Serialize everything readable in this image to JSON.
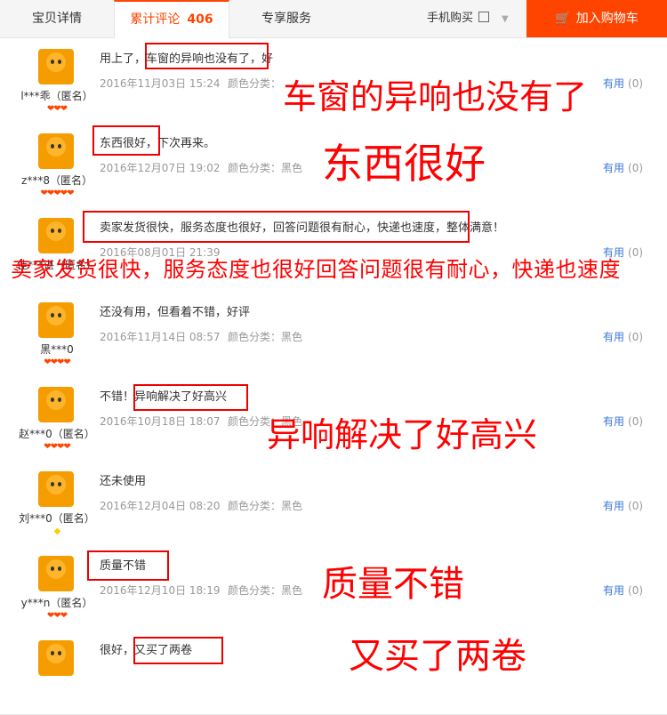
{
  "tabs": {
    "details": "宝贝详情",
    "reviews": "累计评论",
    "reviews_count": "406",
    "services": "专享服务",
    "mobile": "手机购买",
    "cart": "加入购物车"
  },
  "colors": {
    "accent": "#ff4400",
    "link": "#3c78d8",
    "annotation": "#ff0000"
  },
  "useful_label": "有用",
  "reviews": [
    {
      "user": "l***乖（匿名）",
      "content": "用上了，车窗的异响也没有了，好",
      "date": "2016年11月03日 15:24",
      "color": "颜色分类：",
      "useful": "(0)",
      "annotation": "车窗的异响也没有了",
      "hearts": "❤❤❤"
    },
    {
      "user": "z***8（匿名）",
      "content": "东西很好，下次再来。",
      "date": "2016年12月07日 19:02",
      "color": "颜色分类：黑色",
      "useful": "(0)",
      "annotation": "东西很好",
      "hearts": "❤❤❤❤❤"
    },
    {
      "user": "佳***谌（匿名）",
      "content": "卖家发货很快，服务态度也很好，回答问题很有耐心，快递也速度，整体满意！",
      "date": "2016年08月01日 21:39",
      "color": "",
      "useful": "(0)",
      "annotation": "卖家发货很快，服务态度也很好回答问题很有耐心，快递也速度",
      "hearts": ""
    },
    {
      "user": "黑***0",
      "content": "还没有用，但看着不错，好评",
      "date": "2016年11月14日 08:57",
      "color": "颜色分类：黑色",
      "useful": "(0)",
      "annotation": "",
      "hearts": "❤❤❤❤"
    },
    {
      "user": "赵***0（匿名）",
      "content": "不错！异响解决了好高兴",
      "date": "2016年10月18日 18:07",
      "color": "颜色分类：黑色",
      "useful": "(0)",
      "annotation": "异响解决了好高兴",
      "hearts": "❤❤❤❤"
    },
    {
      "user": "刘***0（匿名）",
      "content": "还未使用",
      "date": "2016年12月04日 08:20",
      "color": "颜色分类：黑色",
      "useful": "(0)",
      "annotation": "",
      "hearts": "◆"
    },
    {
      "user": "y***n（匿名）",
      "content": "质量不错",
      "date": "2016年12月10日 18:19",
      "color": "颜色分类：黑色",
      "useful": "(0)",
      "annotation": "质量不错",
      "hearts": "❤❤❤"
    },
    {
      "user": "",
      "content": "很好，又买了两卷",
      "date": "",
      "color": "",
      "useful": "",
      "annotation": "又买了两卷",
      "hearts": ""
    }
  ]
}
